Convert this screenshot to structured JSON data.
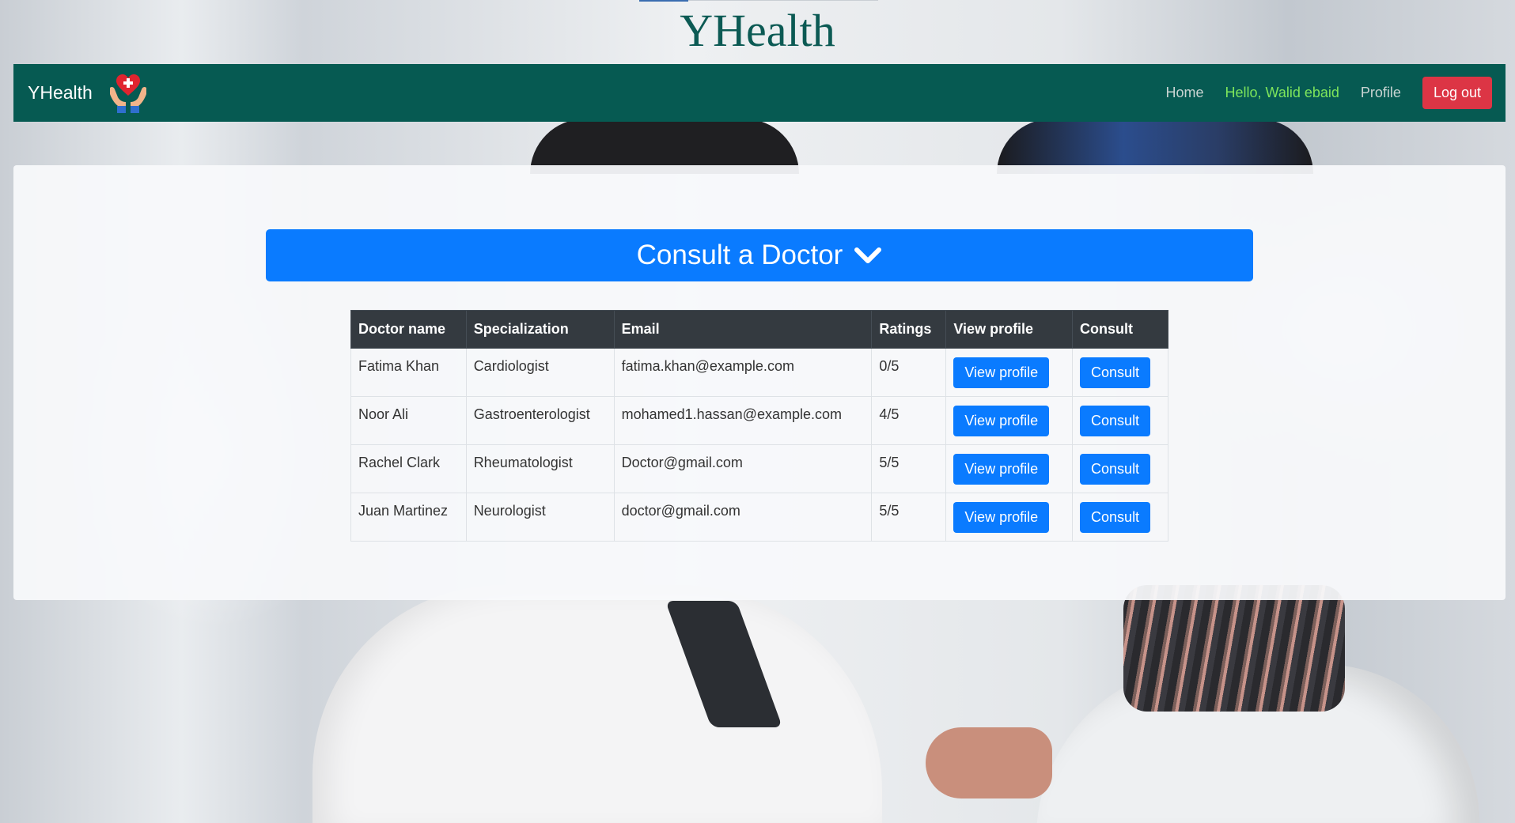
{
  "site_title": "YHealth",
  "navbar": {
    "brand": "YHealth",
    "logo_icon": "heart-hands-icon",
    "links": {
      "home": "Home",
      "greeting": "Hello, Walid ebaid",
      "profile": "Profile",
      "logout": "Log out"
    }
  },
  "main": {
    "banner_label": "Consult a Doctor",
    "banner_icon": "chevron-down-icon",
    "table": {
      "headers": [
        "Doctor name",
        "Specialization",
        "Email",
        "Ratings",
        "View profile",
        "Consult"
      ],
      "rows": [
        {
          "name": "Fatima Khan",
          "specialization": "Cardiologist",
          "email": "fatima.khan@example.com",
          "rating": "0/5",
          "view": "View profile",
          "consult": "Consult"
        },
        {
          "name": "Noor Ali",
          "specialization": "Gastroenterologist",
          "email": "mohamed1.hassan@example.com",
          "rating": "4/5",
          "view": "View profile",
          "consult": "Consult"
        },
        {
          "name": "Rachel Clark",
          "specialization": "Rheumatologist",
          "email": "Doctor@gmail.com",
          "rating": "5/5",
          "view": "View profile",
          "consult": "Consult"
        },
        {
          "name": "Juan Martinez",
          "specialization": "Neurologist",
          "email": "doctor@gmail.com",
          "rating": "5/5",
          "view": "View profile",
          "consult": "Consult"
        }
      ]
    }
  },
  "colors": {
    "navbar": "#065a52",
    "primary": "#0a7bff",
    "danger": "#dc3545",
    "greeting": "#7ee55b",
    "table_header": "#343a40"
  }
}
